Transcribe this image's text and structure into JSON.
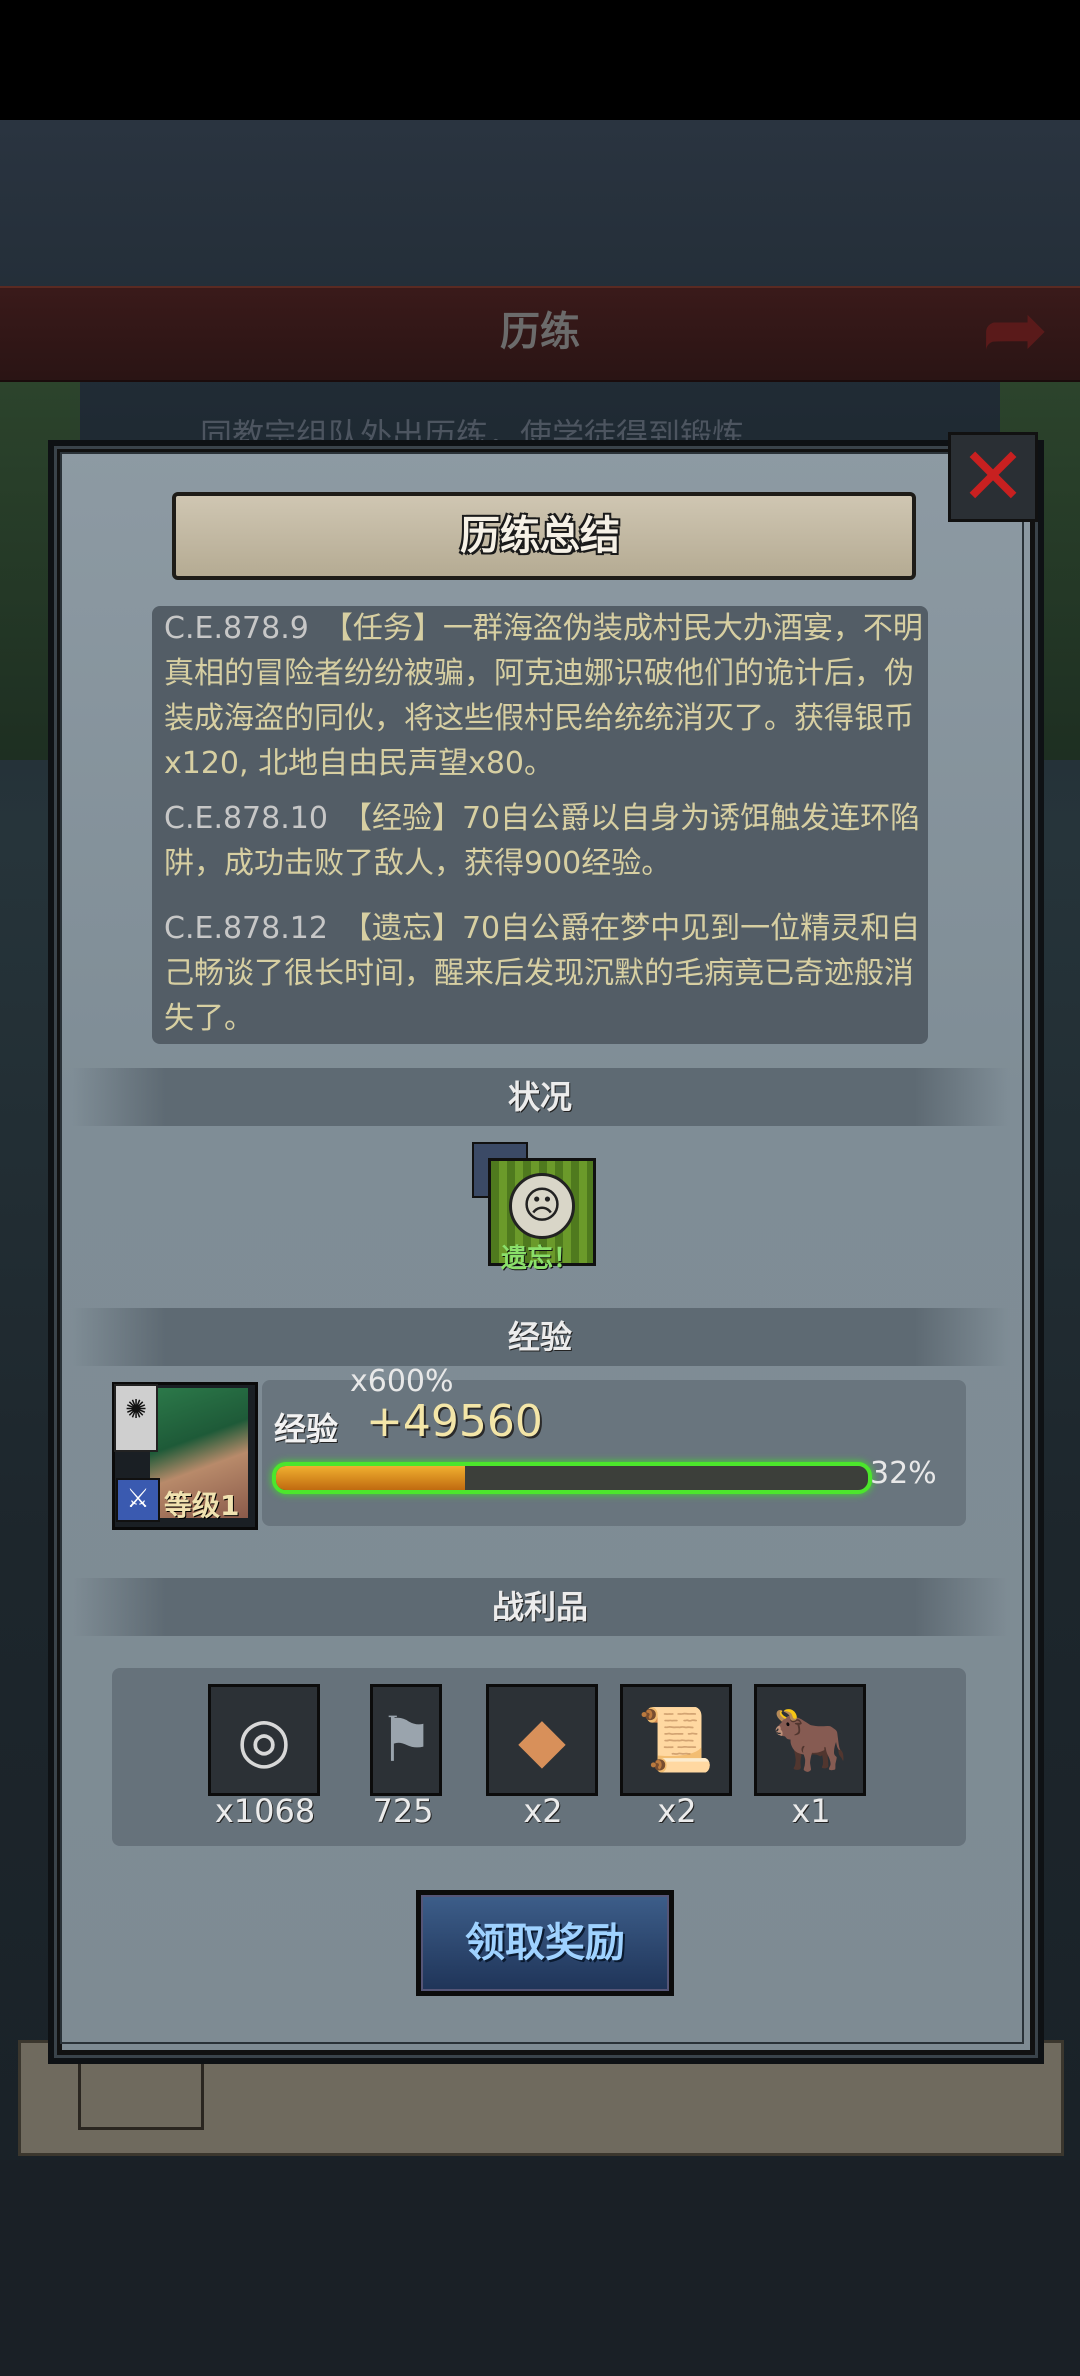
{
  "background": {
    "header_title": "历练",
    "subtitle": "同教宗组队外出历练，使学徒得到锻炼"
  },
  "dialog": {
    "title": "历练总结",
    "log": [
      {
        "date": "C.E.878.9",
        "text": "【任务】一群海盗伪装成村民大办酒宴，不明真相的冒险者纷纷被骗，阿克迪娜识破他们的诡计后，伪装成海盗的同伙，将这些假村民给统统消灭了。获得银币x120, 北地自由民声望x80。"
      },
      {
        "date": "C.E.878.10",
        "text": "【经验】70自公爵以自身为诱饵触发连环陷阱，成功击败了敌人，获得900经验。"
      },
      {
        "date": "C.E.878.12",
        "text": "【遗忘】70自公爵在梦中见到一位精灵和自己畅谈了很长时间，醒来后发现沉默的毛病竟已奇迹般消失了。"
      }
    ],
    "sections": {
      "status": "状况",
      "experience": "经验",
      "loot": "战利品"
    },
    "status_effect": {
      "label": "遗忘！",
      "icon": "sad-face-icon"
    },
    "exp": {
      "multiplier": "x600%",
      "label": "经验",
      "value": "+49560",
      "progress_percent": 32,
      "progress_text": "32%",
      "hero_level": "等级1"
    },
    "loot": [
      {
        "icon": "silver-coin-icon",
        "glyph": "◎",
        "count": "x1068"
      },
      {
        "icon": "faction-banner-icon",
        "glyph": "⚑",
        "count": "725"
      },
      {
        "icon": "ore-icon",
        "glyph": "◆",
        "count": "x2"
      },
      {
        "icon": "scroll-icon",
        "glyph": "📜",
        "count": "x2"
      },
      {
        "icon": "cattle-icon",
        "glyph": "🐂",
        "count": "x1"
      }
    ],
    "claim_button": "领取奖励"
  },
  "colors": {
    "exp_bar_glow": "#4ce62c",
    "close_x": "#c82020",
    "log_text": "#d7cfa2"
  }
}
